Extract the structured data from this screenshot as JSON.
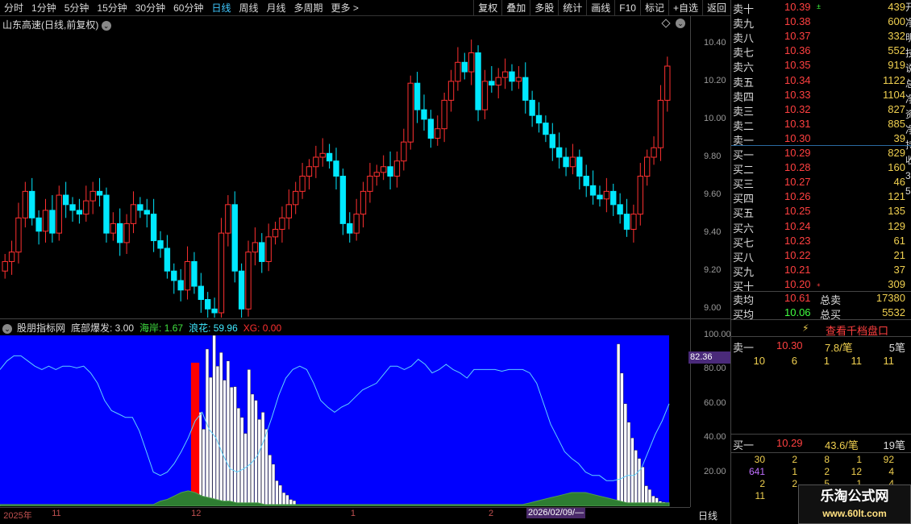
{
  "toolbar": {
    "periods": [
      "分时",
      "1分钟",
      "5分钟",
      "15分钟",
      "30分钟",
      "60分钟",
      "日线",
      "周线",
      "月线",
      "多周期",
      "更多"
    ],
    "active_period": "日线",
    "more_arrow": ">",
    "buttons": [
      "复权",
      "叠加",
      "多股",
      "统计",
      "画线",
      "F10",
      "标记",
      "+自选",
      "返回"
    ]
  },
  "stock": {
    "title": "山东高速(日线,前复权)"
  },
  "price_axis": {
    "labels": [
      "10.40",
      "10.20",
      "10.00",
      "9.80",
      "9.60",
      "9.40",
      "9.20",
      "9.00"
    ],
    "ylim": [
      8.98,
      10.45
    ]
  },
  "indicator": {
    "name": "股朋指标网",
    "items": [
      {
        "label": "底部爆发: 3.00",
        "color": "#dddddd"
      },
      {
        "label": "海岸: 1.67",
        "color": "#40e040"
      },
      {
        "label": "浪花: 59.96",
        "color": "#40e8ff"
      },
      {
        "label": "XG: 0.00",
        "color": "#ff3030"
      }
    ],
    "axis_labels": [
      "100.00",
      "80.00",
      "60.00",
      "40.00",
      "20.00"
    ],
    "current_value": "82.36"
  },
  "xaxis": {
    "labels": [
      {
        "text": "2025年",
        "pos": 0.005
      },
      {
        "text": "11",
        "pos": 0.075
      },
      {
        "text": "12",
        "pos": 0.277
      },
      {
        "text": "1",
        "pos": 0.508
      },
      {
        "text": "2",
        "pos": 0.708
      }
    ],
    "cursor_date": "2026/02/09/—",
    "period_label": "日线"
  },
  "orderbook": {
    "asks": [
      {
        "label": "卖十",
        "price": "10.39",
        "vol": "439",
        "mark": "±"
      },
      {
        "label": "卖九",
        "price": "10.38",
        "vol": "600"
      },
      {
        "label": "卖八",
        "price": "10.37",
        "vol": "332"
      },
      {
        "label": "卖七",
        "price": "10.36",
        "vol": "552"
      },
      {
        "label": "卖六",
        "price": "10.35",
        "vol": "919"
      },
      {
        "label": "卖五",
        "price": "10.34",
        "vol": "1122"
      },
      {
        "label": "卖四",
        "price": "10.33",
        "vol": "1104"
      },
      {
        "label": "卖三",
        "price": "10.32",
        "vol": "827"
      },
      {
        "label": "卖二",
        "price": "10.31",
        "vol": "885"
      },
      {
        "label": "卖一",
        "price": "10.30",
        "vol": "39"
      }
    ],
    "bids": [
      {
        "label": "买一",
        "price": "10.29",
        "vol": "829"
      },
      {
        "label": "买二",
        "price": "10.28",
        "vol": "160"
      },
      {
        "label": "买三",
        "price": "10.27",
        "vol": "46"
      },
      {
        "label": "买四",
        "price": "10.26",
        "vol": "121"
      },
      {
        "label": "买五",
        "price": "10.25",
        "vol": "135"
      },
      {
        "label": "买六",
        "price": "10.24",
        "vol": "129"
      },
      {
        "label": "买七",
        "price": "10.23",
        "vol": "61"
      },
      {
        "label": "买八",
        "price": "10.22",
        "vol": "21"
      },
      {
        "label": "买九",
        "price": "10.21",
        "vol": "37"
      },
      {
        "label": "买十",
        "price": "10.20",
        "vol": "309",
        "mark": "⁎"
      }
    ],
    "avg_sell": {
      "label": "卖均",
      "price": "10.61",
      "total_label": "总卖",
      "total": "17380"
    },
    "avg_buy": {
      "label": "买均",
      "price": "10.06",
      "total_label": "总买",
      "total": "5532"
    }
  },
  "qianbang": {
    "button": "查看千档盘口"
  },
  "queue_ask": {
    "label": "卖一",
    "price": "10.30",
    "per": "7.8/笔",
    "count": "5笔",
    "orders": [
      "10",
      "6",
      "1",
      "11",
      "11"
    ]
  },
  "queue_bid": {
    "label": "买一",
    "price": "10.29",
    "per": "43.6/笔",
    "count": "19笔",
    "rows": [
      [
        "30",
        "2",
        "8",
        "1",
        "92"
      ],
      [
        "641",
        "1",
        "2",
        "12",
        "4"
      ],
      [
        "2",
        "2",
        "5",
        "1",
        "4"
      ],
      [
        "11",
        "",
        "",
        "",
        ""
      ]
    ]
  },
  "right_strip": [
    "开",
    "净",
    "明",
    "技",
    "说",
    "总",
    "净",
    "资",
    "净",
    "持",
    "收",
    "3",
    "5"
  ],
  "logo": {
    "title": "乐淘公式网",
    "url": "www.60lt.com"
  },
  "colors": {
    "up": "#ff3030",
    "down": "#00e8ff",
    "ind_bg": "#0000ff",
    "coast": "#2e7d32",
    "wave": "#60d0ff"
  },
  "chart_data": [
    {
      "type": "candlestick",
      "title": "山东高速(日线,前复权)",
      "ylim": [
        8.98,
        10.45
      ],
      "y_ticks": [
        10.4,
        10.2,
        10.0,
        9.8,
        9.6,
        9.4,
        9.2,
        9.0
      ],
      "x_ticks": [
        "2025年",
        "11",
        "12",
        "1",
        "2"
      ],
      "close": [
        9.25,
        9.3,
        9.48,
        9.62,
        9.48,
        9.41,
        9.52,
        9.4,
        9.6,
        9.55,
        9.52,
        9.5,
        9.57,
        9.62,
        9.6,
        9.4,
        9.45,
        9.35,
        9.45,
        9.55,
        9.52,
        9.5,
        9.36,
        9.32,
        9.2,
        9.15,
        9.1,
        9.25,
        9.12,
        9.05,
        9.0,
        8.98,
        9.4,
        9.55,
        9.2,
        9.0,
        9.3,
        9.35,
        9.25,
        9.38,
        9.42,
        9.48,
        9.55,
        9.62,
        9.7,
        9.75,
        9.8,
        9.82,
        9.78,
        9.7,
        9.45,
        9.4,
        9.5,
        9.62,
        9.7,
        9.72,
        9.75,
        9.7,
        9.78,
        9.88,
        10.19,
        10.05,
        10.0,
        9.9,
        9.95,
        10.1,
        10.2,
        10.3,
        10.25,
        10.35,
        10.05,
        10.2,
        10.18,
        10.22,
        10.25,
        10.2,
        10.22,
        10.1,
        10.02,
        9.98,
        9.92,
        9.85,
        9.8,
        9.75,
        9.8,
        9.7,
        9.65,
        9.6,
        9.58,
        9.62,
        9.55,
        9.5,
        9.42,
        9.5,
        9.7,
        9.8,
        9.85,
        10.1,
        10.28
      ]
    },
    {
      "type": "area",
      "name": "股朋指标网",
      "ylim": [
        0,
        100
      ],
      "y_ticks": [
        100,
        80,
        60,
        40,
        20
      ],
      "series": [
        {
          "name": "浪花",
          "values": [
            80,
            85,
            88,
            88,
            85,
            82,
            80,
            82,
            80,
            82,
            82,
            81,
            82,
            78,
            72,
            62,
            56,
            54,
            52,
            52,
            44,
            32,
            20,
            18,
            20,
            25,
            32,
            40,
            50,
            55,
            45,
            40,
            30,
            22,
            20,
            22,
            25,
            30,
            40,
            52,
            65,
            75,
            80,
            82,
            80,
            72,
            62,
            58,
            55,
            58,
            60,
            64,
            68,
            70,
            72,
            77,
            82,
            82,
            80,
            82,
            86,
            83,
            78,
            80,
            83,
            80,
            78,
            75,
            80,
            80,
            80,
            80,
            79,
            80,
            80,
            80,
            78,
            72,
            60,
            48,
            40,
            32,
            28,
            25,
            20,
            18,
            18,
            15,
            15,
            16,
            18,
            18,
            22,
            32,
            42,
            50,
            60
          ],
          "color": "#60d0ff"
        },
        {
          "name": "海岸",
          "values": [
            1,
            1,
            1,
            1,
            1,
            1,
            1,
            1,
            1,
            1,
            1,
            1,
            1,
            1,
            1,
            1,
            1,
            1,
            1,
            1,
            1,
            1,
            1,
            3,
            4,
            6,
            8,
            9,
            8,
            6,
            5,
            4,
            3,
            3,
            2,
            2,
            2,
            2,
            1,
            1,
            1,
            1,
            1,
            1,
            1,
            1,
            1,
            1,
            1,
            1,
            1,
            1,
            1,
            1,
            1,
            1,
            1,
            1,
            1,
            1,
            1,
            1,
            1,
            1,
            1,
            1,
            1,
            1,
            1,
            1,
            1,
            1,
            1,
            1,
            1,
            1,
            2,
            3,
            4,
            5,
            6,
            7,
            8,
            8,
            8,
            7,
            6,
            5,
            4,
            3,
            2,
            2,
            2,
            2,
            2,
            2,
            2
          ],
          "color": "#2e7d32"
        },
        {
          "name": "底部爆发",
          "values": [
            0,
            0,
            0,
            0,
            0,
            0,
            0,
            0,
            0,
            0,
            0,
            0,
            0,
            0,
            0,
            0,
            0,
            0,
            0,
            0,
            0,
            0,
            0,
            0,
            0,
            0,
            0,
            0,
            0,
            55,
            92,
            100,
            90,
            85,
            70,
            52,
            80,
            62,
            55,
            30,
            15,
            8,
            4,
            0,
            0,
            0,
            0,
            0,
            0,
            0,
            0,
            0,
            0,
            0,
            0,
            0,
            0,
            0,
            0,
            0,
            0,
            0,
            0,
            0,
            0,
            0,
            0,
            0,
            0,
            0,
            0,
            0,
            0,
            0,
            0,
            0,
            0,
            0,
            0,
            0,
            0,
            0,
            0,
            0,
            0,
            0,
            0,
            0,
            0,
            95,
            60,
            40,
            28,
            12,
            6,
            3,
            0
          ],
          "color": "#ffffff"
        },
        {
          "name": "XG",
          "values": [
            0,
            0,
            0,
            0,
            0,
            0,
            0,
            0,
            0,
            0,
            0,
            0,
            0,
            0,
            0,
            0,
            0,
            0,
            0,
            0,
            0,
            0,
            0,
            0,
            0,
            0,
            0,
            0,
            84,
            0,
            0,
            0,
            0,
            0,
            0,
            0,
            0,
            0,
            0,
            0,
            0,
            0,
            0,
            0,
            0,
            0,
            0,
            0,
            0,
            0,
            0,
            0,
            0,
            0,
            0,
            0,
            0,
            0,
            0,
            0,
            0,
            0,
            0,
            0,
            0,
            0,
            0,
            0,
            0,
            0,
            0,
            0,
            0,
            0,
            0,
            0,
            0,
            0,
            0,
            0,
            0,
            0,
            0,
            0,
            0,
            0,
            0,
            0,
            0,
            0,
            0,
            0,
            0,
            0,
            0,
            0,
            0
          ],
          "color": "#ff0000"
        }
      ]
    }
  ]
}
